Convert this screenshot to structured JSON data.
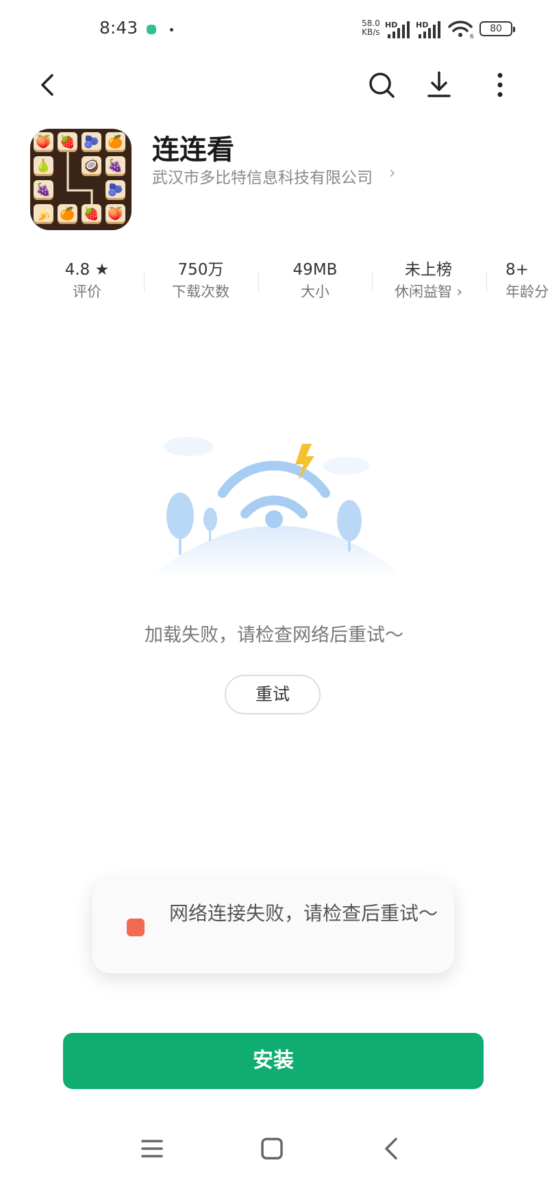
{
  "status_bar": {
    "time": "8:43",
    "net_speed_value": "58.0",
    "net_speed_unit": "KB/s",
    "signal_label_1": "HD",
    "signal_label_2": "HD",
    "wifi_badge": "6",
    "battery": "80"
  },
  "toolbar": {
    "back_icon": "back-arrow-icon",
    "search_icon": "search-icon",
    "download_icon": "download-icon",
    "more_icon": "more-vertical-icon"
  },
  "app": {
    "name": "连连看",
    "developer": "武汉市多比特信息科技有限公司",
    "developer_chevron": "›"
  },
  "stats": [
    {
      "value": "4.8 ★",
      "label": "评价"
    },
    {
      "value": "750万",
      "label": "下载次数"
    },
    {
      "value": "49MB",
      "label": "大小"
    },
    {
      "value": "未上榜",
      "label": "休闲益智 ›"
    },
    {
      "value": "8+",
      "label": "年龄分级"
    }
  ],
  "error": {
    "message": "加载失败，请检查网络后重试～",
    "retry_label": "重试"
  },
  "toast": {
    "message": "网络连接失败，请检查后重试～"
  },
  "install": {
    "label": "安装"
  },
  "colors": {
    "accent": "#10ad72",
    "illustration_blue": "#a8cdf3",
    "bolt": "#f5c130"
  }
}
